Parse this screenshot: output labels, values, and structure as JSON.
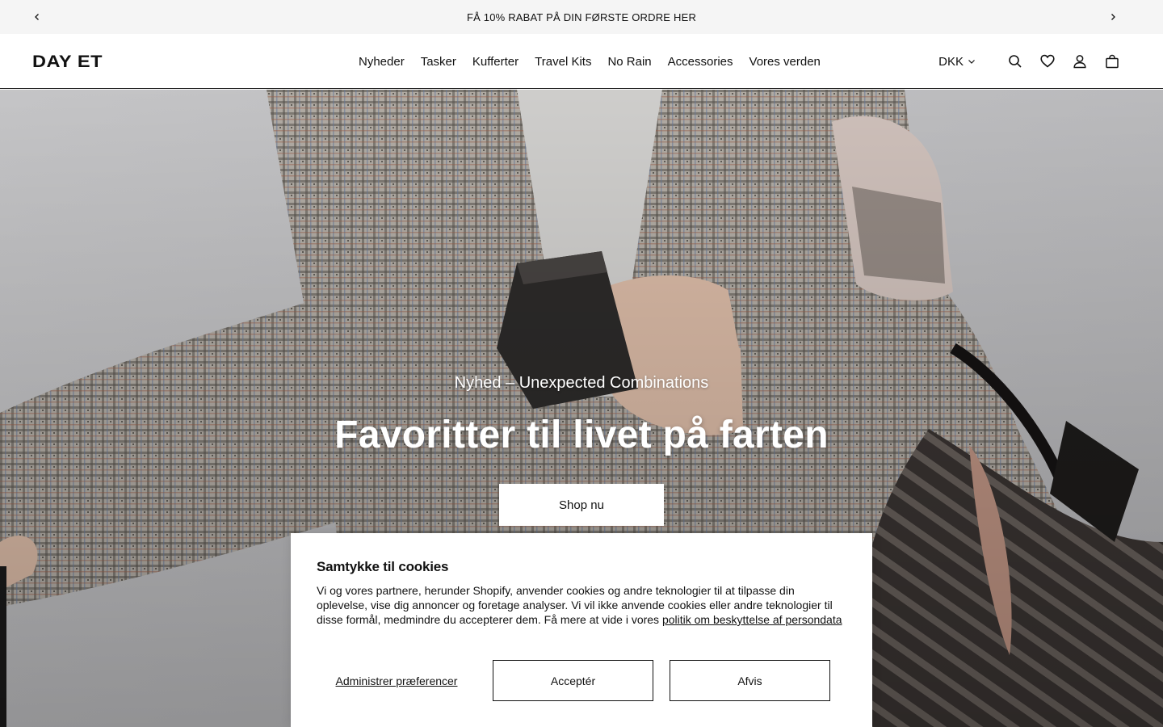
{
  "announcement": {
    "text": "FÅ 10% RABAT PÅ DIN FØRSTE ORDRE HER",
    "prev_icon": "chevron-left-icon",
    "next_icon": "chevron-right-icon"
  },
  "header": {
    "logo": "DAY ET",
    "nav": [
      "Nyheder",
      "Tasker",
      "Kufferter",
      "Travel Kits",
      "No Rain",
      "Accessories",
      "Vores verden"
    ],
    "currency": "DKK",
    "icons": [
      "search-icon",
      "heart-icon",
      "user-icon",
      "bag-icon"
    ]
  },
  "hero": {
    "subtitle": "Nyhed – Unexpected Combinations",
    "title": "Favoritter til livet på farten",
    "cta": "Shop nu"
  },
  "cookie": {
    "title": "Samtykke til cookies",
    "body": "Vi og vores partnere, herunder Shopify, anvender cookies og andre teknologier til at tilpasse din oplevelse, vise dig annoncer og foretage analyser. Vi vil ikke anvende cookies eller andre teknologier til disse formål, medmindre du accepterer dem. Få mere at vide i vores ",
    "link": "politik om beskyttelse af persondata",
    "manage": "Administrer præferencer",
    "accept": "Acceptér",
    "decline": "Afvis"
  },
  "colors": {
    "announce_bg": "#f5f5f5",
    "text": "#111111",
    "hero_bg": "#c9c9cb"
  }
}
